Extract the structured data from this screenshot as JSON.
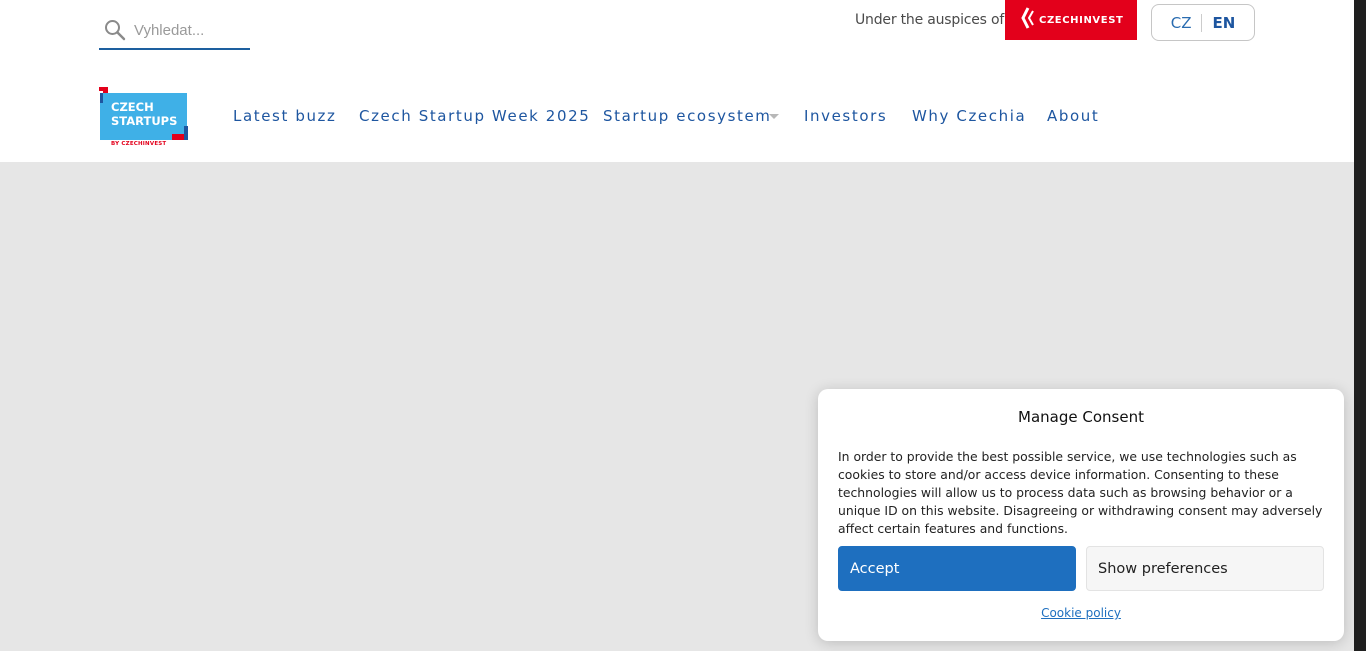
{
  "search": {
    "placeholder": "Vyhledat..."
  },
  "header": {
    "auspices_text": "Under the auspices of",
    "partner_logo_text": "CZECHINVEST",
    "languages": [
      "CZ",
      "EN"
    ],
    "active_language": "EN"
  },
  "brand": {
    "line1": "CZECH",
    "line2": "STARTUPS",
    "line3": "BY CZECHINVEST"
  },
  "nav": {
    "items": [
      {
        "label": "Latest buzz"
      },
      {
        "label": "Czech Startup Week 2025"
      },
      {
        "label": "Startup ecosystem"
      },
      {
        "label": "Investors"
      },
      {
        "label": "Why Czechia"
      },
      {
        "label": "About"
      }
    ]
  },
  "consent": {
    "title": "Manage Consent",
    "body": "In order to provide the best possible service, we use technologies such as cookies to store and/or access device information. Consenting to these technologies will allow us to process data such as browsing behavior or a unique ID on this website. Disagreeing or withdrawing consent may adversely affect certain features and functions.",
    "accept_label": "Accept",
    "preferences_label": "Show preferences",
    "policy_link": "Cookie policy"
  },
  "colors": {
    "brand_blue": "#1e56a0",
    "accent_red": "#e3001b",
    "logo_sky": "#3fb0e7",
    "accept_blue": "#1e6fbf"
  },
  "icons": [
    "search-icon",
    "czechinvest-mark-icon",
    "chevron-down-icon"
  ]
}
